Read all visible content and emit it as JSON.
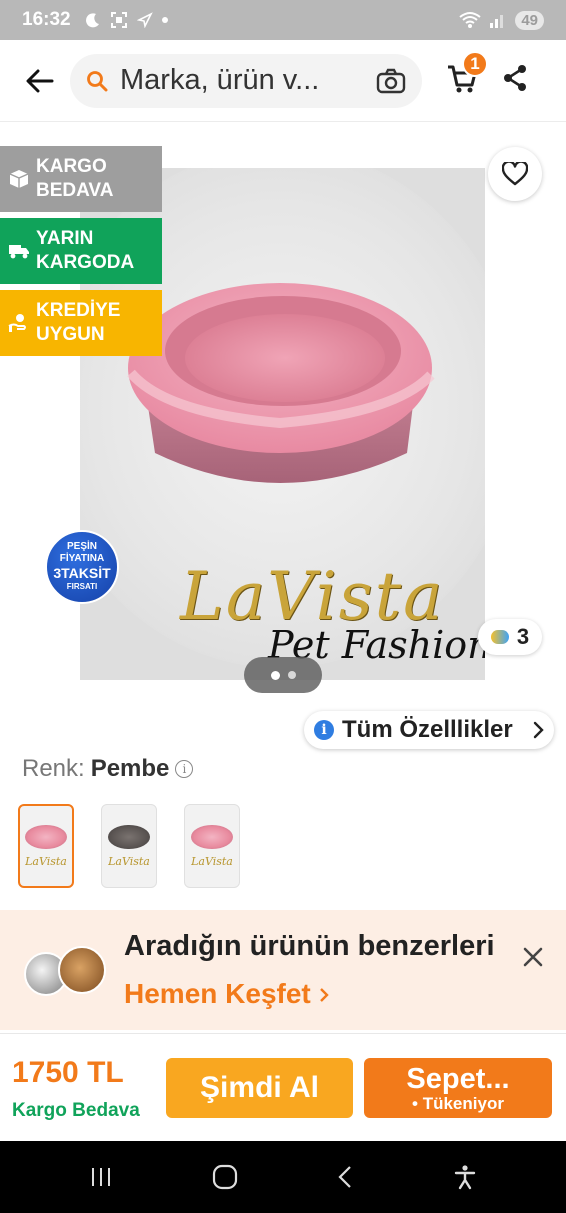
{
  "status_bar": {
    "time": "16:32",
    "battery": "49"
  },
  "top_nav": {
    "search_placeholder": "Marka, ürün v...",
    "cart_count": "1"
  },
  "product_media": {
    "badges": [
      {
        "line1": "KARGO",
        "line2": "BEDAVA",
        "icon": "box-icon",
        "color": "#9e9e9e"
      },
      {
        "line1": "YARIN",
        "line2": "KARGODA",
        "icon": "truck-icon",
        "color": "#10a35a"
      },
      {
        "line1": "KREDİYE",
        "line2": "UYGUN",
        "icon": "coins-hand-icon",
        "color": "#f8b500"
      }
    ],
    "taksit_sticker": {
      "l1": "PEŞİN",
      "l2": "FİYATINA",
      "l3": "3TAKSİT",
      "l4": "FIRSATI"
    },
    "brand_logo": {
      "line1": "LaVista",
      "line2": "Pet Fashion"
    },
    "photo_count": "3",
    "pager": {
      "total": 2,
      "active": 1
    }
  },
  "features_button": {
    "label": "Tüm Özelllikler"
  },
  "variant": {
    "label": "Renk:",
    "value": "Pembe",
    "thumbnails": [
      {
        "color": "#e88a9e",
        "selected": true,
        "logo": "LaVista"
      },
      {
        "color": "#5a5452",
        "selected": false,
        "logo": "LaVista"
      },
      {
        "color": "#e88a9e",
        "selected": false,
        "logo": "LaVista"
      }
    ]
  },
  "promo": {
    "title": "Aradığın ürünün benzerleri",
    "link": "Hemen Keşfet"
  },
  "action_bar": {
    "price": "1750 TL",
    "shipping": "Kargo Bedava",
    "buy_now": "Şimdi Al",
    "add_to_cart": "Sepet...",
    "stock_note": "• Tükeniyor"
  },
  "colors": {
    "accent": "#f27a1a",
    "green": "#10a35a",
    "yellow": "#f8b500",
    "buy_button": "#f9a720"
  }
}
